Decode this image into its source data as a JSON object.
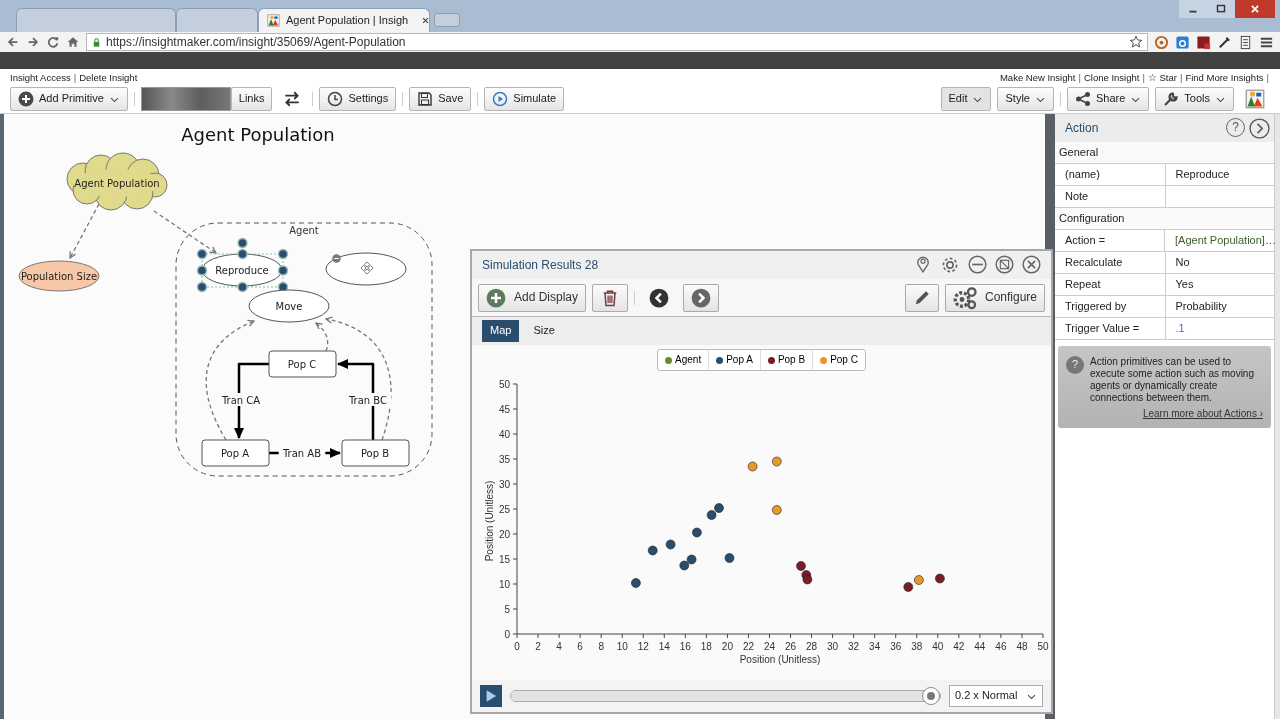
{
  "browser": {
    "tabs": [
      {
        "selected": false
      },
      {
        "selected": false
      },
      {
        "selected": true,
        "title": "Agent Population | Insigh"
      }
    ],
    "url": "https://insightmaker.com/insight/35069/Agent-Population"
  },
  "top_links": {
    "separator": "|",
    "left": [
      "Insight Access",
      "Delete Insight"
    ],
    "right": [
      "Make New Insight",
      "Clone Insight",
      "☆ Star",
      "Find More Insights"
    ]
  },
  "toolbar": {
    "left": [
      {
        "kind": "dropdown",
        "label": "Add Primitive"
      },
      {
        "kind": "segment",
        "label": "Links"
      },
      {
        "kind": "icon"
      },
      {
        "kind": "button",
        "label": "Settings"
      },
      {
        "kind": "button",
        "label": "Save"
      },
      {
        "kind": "button",
        "label": "Simulate"
      }
    ],
    "right": [
      {
        "kind": "dropdown",
        "label": "Edit"
      },
      {
        "kind": "dropdown",
        "label": "Style"
      },
      {
        "kind": "dropdown",
        "label": "Share"
      },
      {
        "kind": "dropdown",
        "label": "Tools"
      },
      {
        "kind": "icon"
      }
    ]
  },
  "diagram": {
    "title": "Agent Population",
    "folder": {
      "label": "Agent"
    },
    "nodes": [
      {
        "kind": "cloud",
        "label": "Agent Population",
        "selected": false
      },
      {
        "kind": "converter",
        "label": "Population Size",
        "selected": false
      },
      {
        "kind": "action",
        "label": "Reproduce",
        "selected": true
      },
      {
        "kind": "action",
        "selected": false
      },
      {
        "kind": "action",
        "label": "Move",
        "selected": false
      },
      {
        "kind": "state",
        "label": "Pop C",
        "selected": false
      },
      {
        "kind": "state",
        "label": "Pop A",
        "selected": false
      },
      {
        "kind": "state",
        "label": "Pop B",
        "selected": false
      }
    ],
    "transitions": [
      {
        "label": "Tran CA"
      },
      {
        "label": "Tran BC"
      },
      {
        "label": "Tran AB"
      }
    ]
  },
  "results": {
    "title": "Simulation Results 28",
    "toolbar": [
      {
        "kind": "add",
        "label": "Add Display"
      },
      {
        "kind": "delete"
      },
      {
        "kind": "prev"
      },
      {
        "kind": "next"
      },
      {
        "kind": "edit"
      },
      {
        "kind": "configure",
        "label": "Configure"
      }
    ],
    "tabs": [
      {
        "label": "Map",
        "selected": true
      },
      {
        "label": "Size",
        "selected": false
      }
    ],
    "chart_data": {
      "type": "scatter",
      "xlabel": "Position (Unitless)",
      "ylabel": "Position (Unitless)",
      "xlim": [
        0,
        50
      ],
      "ylim": [
        0,
        50
      ],
      "xticks": [
        0,
        2,
        4,
        6,
        8,
        10,
        12,
        14,
        16,
        18,
        20,
        22,
        24,
        26,
        28,
        30,
        32,
        34,
        36,
        38,
        40,
        42,
        44,
        46,
        48,
        50
      ],
      "yticks": [
        0,
        5,
        10,
        15,
        20,
        25,
        30,
        35,
        40,
        45,
        50
      ],
      "series": [
        {
          "name": "Agent",
          "color": "#6b8a2e"
        },
        {
          "name": "Pop A",
          "color": "#2a4d6e",
          "x": [
            11.3,
            12.9,
            14.6,
            15.9,
            16.6,
            17.1,
            18.5,
            19.2,
            20.2
          ],
          "values": [
            10.2,
            16.7,
            17.9,
            13.7,
            14.9,
            20.3,
            23.8,
            25.2,
            15.2
          ]
        },
        {
          "name": "Pop B",
          "color": "#7a1c2a",
          "x": [
            27.0,
            27.5,
            27.6,
            37.2,
            40.2
          ],
          "values": [
            13.6,
            11.8,
            10.9,
            9.4,
            11.1
          ]
        },
        {
          "name": "Pop C",
          "color": "#e8962e",
          "x": [
            22.4,
            24.7,
            24.7,
            38.2
          ],
          "values": [
            33.5,
            34.5,
            24.8,
            10.8
          ]
        }
      ]
    },
    "playback": {
      "level": 0.98,
      "speed": "0.2 x Normal"
    }
  },
  "panel": {
    "title": "Action",
    "help_glyph": "?",
    "sections": [
      {
        "title": "General",
        "rows": [
          {
            "label": "(name)",
            "value": "Reproduce",
            "kind": "text"
          },
          {
            "label": "Note"
          }
        ]
      },
      {
        "title": "Configuration",
        "rows": [
          {
            "label": "Action =",
            "value": "[Agent Population]…",
            "kind": "formula"
          },
          {
            "label": "Recalculate",
            "value": "No",
            "kind": "text"
          },
          {
            "label": "Repeat",
            "value": "Yes",
            "kind": "text"
          },
          {
            "label": "Triggered by",
            "value": "Probability",
            "kind": "text"
          },
          {
            "label": "Trigger Value =",
            "value": ".1",
            "kind": "number"
          }
        ]
      }
    ],
    "help": {
      "glyph": "?",
      "text": "Action primitives can be used to execute some action such as moving agents or dynamically create connections between them.",
      "link": "Learn more about Actions ›"
    }
  }
}
